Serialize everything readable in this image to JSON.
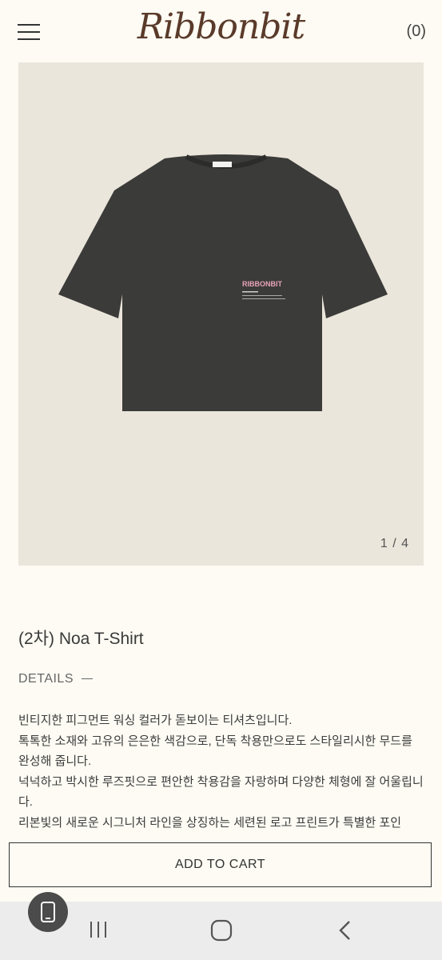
{
  "header": {
    "logo_text": "Ribbonbit",
    "cart_count": "(0)"
  },
  "gallery": {
    "counter": "1 / 4",
    "shirt_print": "RIBBONBIT"
  },
  "product": {
    "title": "(2차) Noa T-Shirt"
  },
  "details": {
    "label": "DETAILS",
    "description": [
      "빈티지한 피그먼트 워싱 컬러가 돋보이는 티셔츠입니다.",
      "톡톡한 소재와 고유의 은은한 색감으로, 단독 착용만으로도 스타일리시한 무드를 완성해 줍니다.",
      "넉넉하고 박시한 루즈핏으로 편안한 착용감을 자랑하며 다양한 체형에 잘 어울립니다.",
      "리본빛의 새로운 시그니처 라인을 상징하는 세련된 로고 프린트가 특별한 포인"
    ]
  },
  "cart": {
    "button_label": "ADD TO CART"
  },
  "colors": {
    "background": "#fdfbf3",
    "gallery_bg": "#ebe6dc",
    "shirt": "#3b3b39",
    "logo": "#5a3a2a",
    "print_pink": "#e8a3b8"
  },
  "icons": [
    "menu-icon",
    "recent-apps-icon",
    "home-icon",
    "back-icon",
    "phone-icon"
  ]
}
